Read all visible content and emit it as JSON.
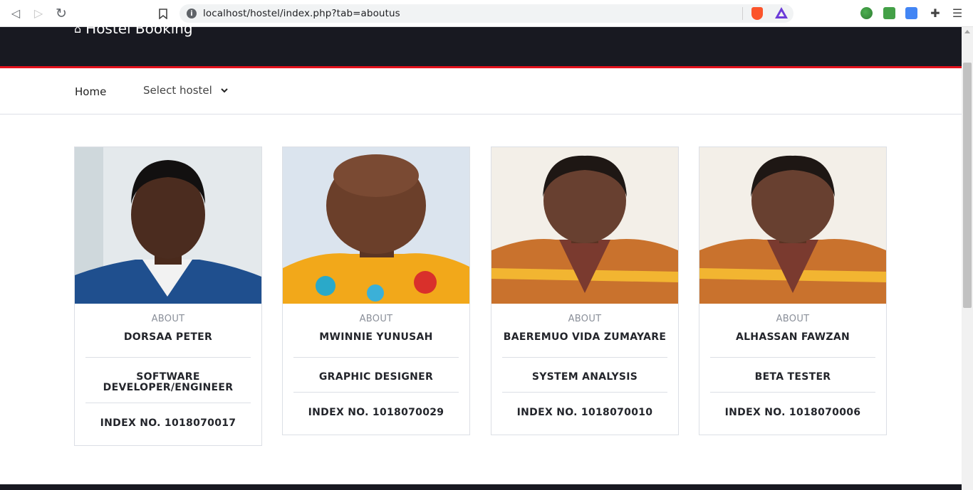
{
  "browser": {
    "url": "localhost/hostel/index.php?tab=aboutus",
    "info_glyph": "i",
    "back_glyph": "◁",
    "forward_glyph": "▷",
    "reload_glyph": "↻",
    "bookmark_glyph": "🔖",
    "extensions_glyph": "✚",
    "menu_glyph": "☰"
  },
  "header": {
    "brand": "Hostel Booking",
    "home_glyph": "⌂",
    "accent_color": "#e4111c",
    "bg_color": "#181921"
  },
  "nav": {
    "home_label": "Home",
    "select_label": "Select hostel",
    "chevron": "⌄"
  },
  "team": [
    {
      "about": "ABOUT",
      "name": "DORSAA PETER",
      "role": "SOFTWARE DEVELOPER/ENGINEER",
      "index": "INDEX NO. 1018070017"
    },
    {
      "about": "ABOUT",
      "name": "MWINNIE YUNUSAH",
      "role": "GRAPHIC DESIGNER",
      "index": "INDEX NO. 1018070029"
    },
    {
      "about": "ABOUT",
      "name": "BAEREMUO VIDA ZUMAYARE",
      "role": "SYSTEM ANALYSIS",
      "index": "INDEX NO. 1018070010"
    },
    {
      "about": "ABOUT",
      "name": "ALHASSAN FAWZAN",
      "role": "BETA TESTER",
      "index": "INDEX NO. 1018070006"
    }
  ]
}
